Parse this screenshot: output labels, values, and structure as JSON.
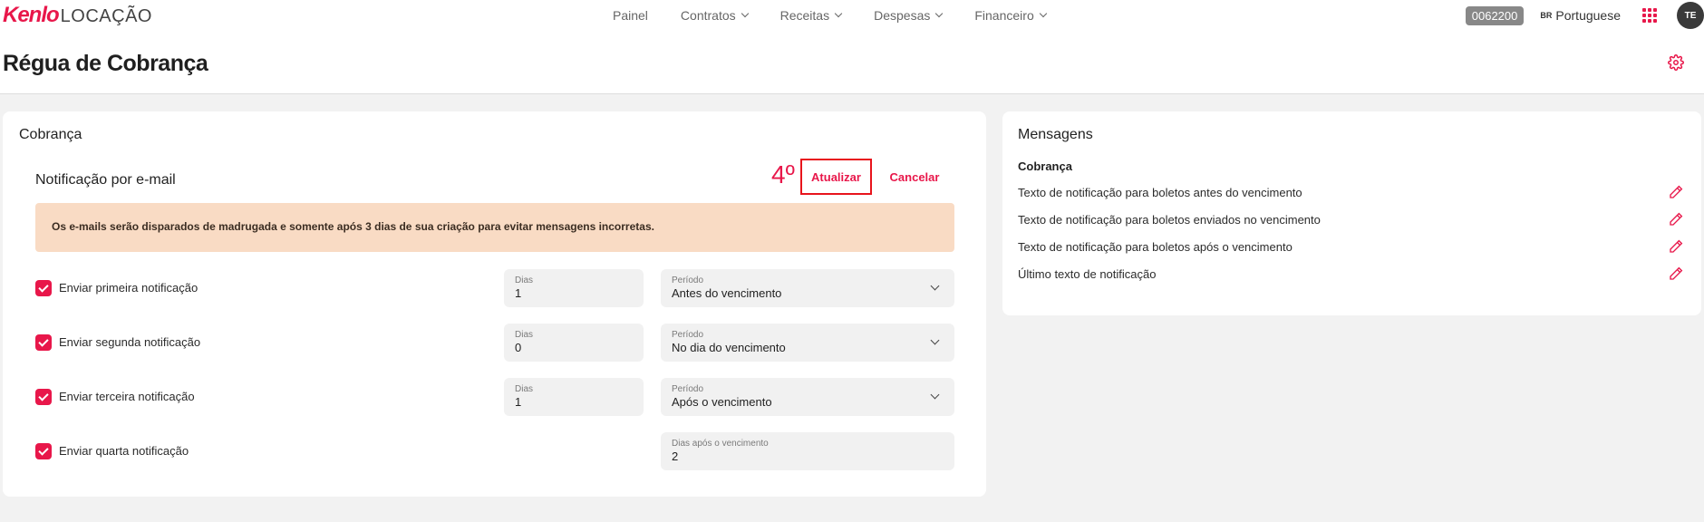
{
  "app": {
    "logo_brand": "Kenlo",
    "logo_sub": "LOCAÇÃO",
    "accent_color": "#e8174a"
  },
  "nav": {
    "items": [
      {
        "label": "Painel",
        "dropdown": false
      },
      {
        "label": "Contratos",
        "dropdown": true
      },
      {
        "label": "Receitas",
        "dropdown": true
      },
      {
        "label": "Despesas",
        "dropdown": true
      },
      {
        "label": "Financeiro",
        "dropdown": true
      }
    ]
  },
  "topright": {
    "account_code": "0062200",
    "language_flag": "BR",
    "language": "Portuguese",
    "apps_icon": "grid-icon",
    "avatar_initials": "TE"
  },
  "page": {
    "title": "Régua de Cobrança",
    "settings_icon": "gear-icon"
  },
  "billing_card": {
    "title": "Cobrança",
    "section_title": "Notificação por e-mail",
    "step_mark": "4º",
    "update_label": "Atualizar",
    "cancel_label": "Cancelar",
    "alert_text": "Os e-mails serão disparados de madrugada e somente após 3 dias de sua criação para evitar mensagens incorretas.",
    "rows": [
      {
        "label": "Enviar primeira notificação",
        "checked": true,
        "days_label": "Dias",
        "days_value": "1",
        "period_label": "Período",
        "period_value": "Antes do vencimento"
      },
      {
        "label": "Enviar segunda notificação",
        "checked": true,
        "days_label": "Dias",
        "days_value": "0",
        "period_label": "Período",
        "period_value": "No dia do vencimento"
      },
      {
        "label": "Enviar terceira notificação",
        "checked": true,
        "days_label": "Dias",
        "days_value": "1",
        "period_label": "Período",
        "period_value": "Após o vencimento"
      },
      {
        "label": "Enviar quarta notificação",
        "checked": true,
        "after_label": "Dias após o vencimento",
        "after_value": "2"
      }
    ]
  },
  "messages_card": {
    "title": "Mensagens",
    "subtitle": "Cobrança",
    "items": [
      {
        "label": "Texto de notificação para boletos antes do vencimento"
      },
      {
        "label": "Texto de notificação para boletos enviados no vencimento"
      },
      {
        "label": "Texto de notificação para boletos após o vencimento"
      },
      {
        "label": "Último texto de notificação"
      }
    ],
    "edit_icon": "pencil-icon"
  }
}
